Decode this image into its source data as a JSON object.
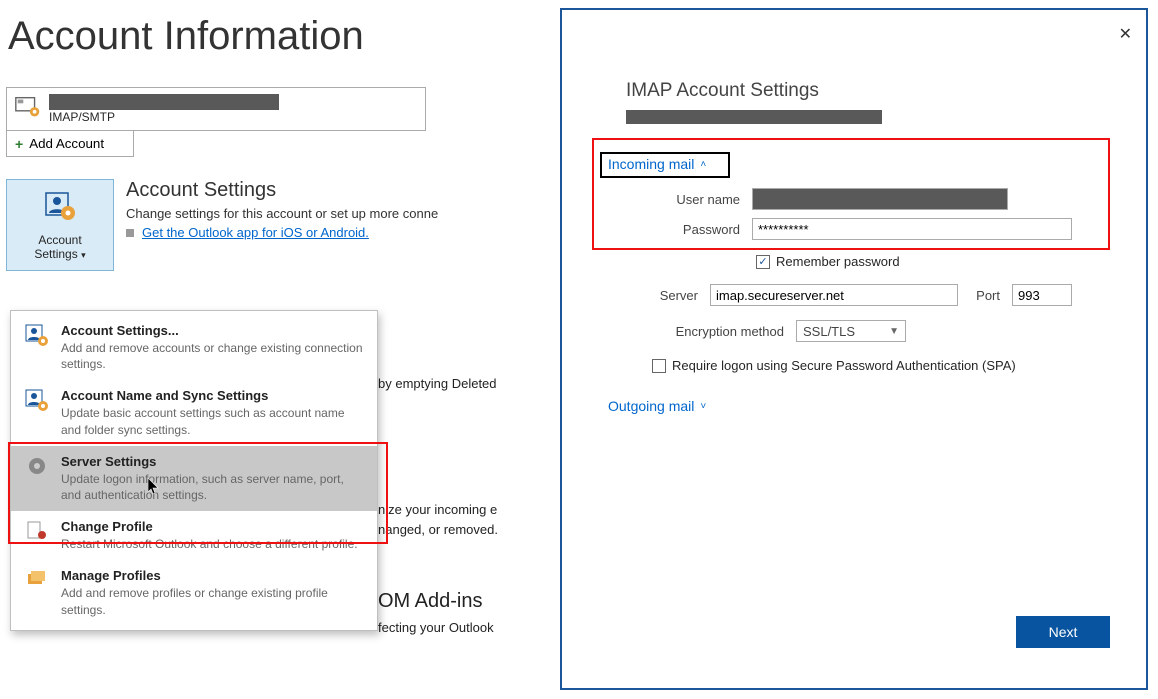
{
  "left": {
    "page_title": "Account Information",
    "account_type": "IMAP/SMTP",
    "add_account": "Add Account",
    "settings_btn_line1": "Account",
    "settings_btn_line2": "Settings",
    "settings_heading": "Account Settings",
    "settings_desc": "Change settings for this account or set up more conne",
    "app_link": "Get the Outlook app for iOS or Android.",
    "menu": [
      {
        "title": "Account Settings...",
        "desc": "Add and remove accounts or change existing connection settings."
      },
      {
        "title": "Account Name and Sync Settings",
        "desc": "Update basic account settings such as account name and folder sync settings."
      },
      {
        "title": "Server Settings",
        "desc": "Update logon information, such as server name, port, and authentication settings."
      },
      {
        "title": "Change Profile",
        "desc": "Restart Microsoft Outlook and choose a different profile."
      },
      {
        "title": "Manage Profiles",
        "desc": "Add and remove profiles or change existing profile settings."
      }
    ],
    "bg": {
      "t1": "by emptying Deleted",
      "t2": "nize your incoming e",
      "t3": "nanged, or removed.",
      "t4": "OM Add-ins",
      "t5": "fecting your Outlook"
    }
  },
  "dialog": {
    "title": "IMAP Account Settings",
    "incoming_header": "Incoming mail",
    "outgoing_header": "Outgoing mail",
    "labels": {
      "username": "User name",
      "password": "Password",
      "server": "Server",
      "port": "Port",
      "encryption": "Encryption method",
      "remember": "Remember password",
      "spa": "Require logon using Secure Password Authentication (SPA)"
    },
    "values": {
      "password": "**********",
      "server": "imap.secureserver.net",
      "port": "993",
      "encryption": "SSL/TLS"
    },
    "next": "Next"
  }
}
